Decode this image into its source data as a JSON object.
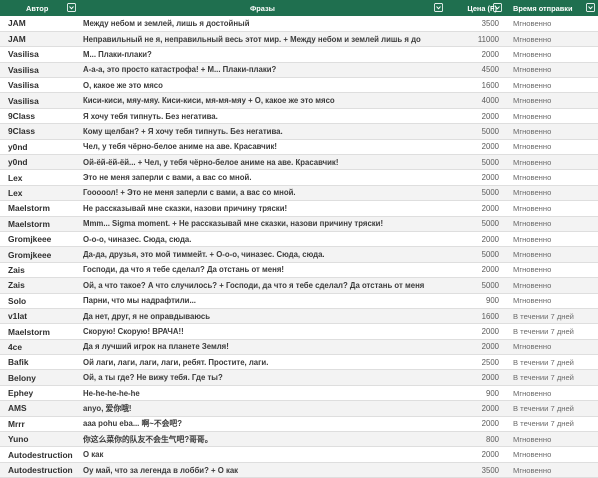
{
  "header": {
    "col_author": "Автор",
    "col_phrase": "Фразы",
    "col_price": "Цена (F)",
    "col_time": "Время отправки"
  },
  "rows": [
    {
      "author": "JAM",
      "phrase": "Между небом и землей, лишь я достойный",
      "price": "3500",
      "time": "Мгновенно"
    },
    {
      "author": "JAM",
      "phrase": "Неправильный не я, неправильный весь этот мир. + Между небом и землей лишь я до",
      "price": "11000",
      "time": "Мгновенно"
    },
    {
      "author": "Vasilisa",
      "phrase": "М... Плаки-плаки?",
      "price": "2000",
      "time": "Мгновенно"
    },
    {
      "author": "Vasilisa",
      "phrase": "А-а-а, это просто катастрофа! + М... Плаки-плаки?",
      "price": "4500",
      "time": "Мгновенно"
    },
    {
      "author": "Vasilisa",
      "phrase": "О, какое же это мясо",
      "price": "1600",
      "time": "Мгновенно"
    },
    {
      "author": "Vasilisa",
      "phrase": "Киси-киси, мяу-мяу. Киси-киси, мя-мя-мяу + О, какое же это мясо",
      "price": "4000",
      "time": "Мгновенно"
    },
    {
      "author": "9Class",
      "phrase": "Я хочу тебя типнуть. Без негатива.",
      "price": "2000",
      "time": "Мгновенно"
    },
    {
      "author": "9Class",
      "phrase": "Кому щелбан? + Я хочу тебя типнуть. Без негатива.",
      "price": "5000",
      "time": "Мгновенно"
    },
    {
      "author": "y0nd",
      "phrase": "Чел, у тебя чёрно-белое аниме на аве. Красавчик!",
      "price": "2000",
      "time": "Мгновенно"
    },
    {
      "author": "y0nd",
      "phrase": "Ой-ёй-ёй-ёй... + Чел, у тебя чёрно-белое аниме на аве. Красавчик!",
      "price": "5000",
      "time": "Мгновенно"
    },
    {
      "author": "Lex",
      "phrase": "Это не меня заперли с вами, а вас со мной.",
      "price": "2000",
      "time": "Мгновенно"
    },
    {
      "author": "Lex",
      "phrase": "Гооооол! + Это не меня заперли с вами, а вас со мной.",
      "price": "5000",
      "time": "Мгновенно"
    },
    {
      "author": "Maelstorm",
      "phrase": "Не рассказывай мне сказки, назови причину тряски!",
      "price": "2000",
      "time": "Мгновенно"
    },
    {
      "author": "Maelstorm",
      "phrase": "Mmm... Sigma moment. + Не рассказывай мне сказки, назови причину тряски!",
      "price": "5000",
      "time": "Мгновенно"
    },
    {
      "author": "Gromjkeee",
      "phrase": "О-о-о, чиназес. Сюда, сюда.",
      "price": "2000",
      "time": "Мгновенно"
    },
    {
      "author": "Gromjkeee",
      "phrase": "Да-да, друзья, это мой тиммейт. + О-о-о, чиназес. Сюда, сюда.",
      "price": "5000",
      "time": "Мгновенно"
    },
    {
      "author": "Zais",
      "phrase": "Господи, да что я тебе сделал? Да отстань от меня!",
      "price": "2000",
      "time": "Мгновенно"
    },
    {
      "author": "Zais",
      "phrase": "Ой, а что такое? А что случилось? + Господи, да что я тебе сделал? Да отстань от меня",
      "price": "5000",
      "time": "Мгновенно"
    },
    {
      "author": "Solo",
      "phrase": "Парни, что мы надрафтили...",
      "price": "900",
      "time": "Мгновенно"
    },
    {
      "author": "v1lat",
      "phrase": "Да нет, друг, я не оправдываюсь",
      "price": "1600",
      "time": "В течении 7 дней"
    },
    {
      "author": "Maelstorm",
      "phrase": "Скорую! Скорую! ВРАЧА!!",
      "price": "2000",
      "time": "В течении 7 дней"
    },
    {
      "author": "4ce",
      "phrase": "Да я лучший игрок на планете Земля!",
      "price": "2000",
      "time": "Мгновенно"
    },
    {
      "author": "Bafik",
      "phrase": "Ой лаги, лаги, лаги, лаги, ребят. Простите, лаги.",
      "price": "2500",
      "time": "В течении 7 дней"
    },
    {
      "author": "Belony",
      "phrase": "Ой, а ты где? Не вижу тебя. Где ты?",
      "price": "2000",
      "time": "В течении 7 дней"
    },
    {
      "author": "Ephey",
      "phrase": "He-he-he-he-he",
      "price": "900",
      "time": "Мгновенно"
    },
    {
      "author": "AMS",
      "phrase": "anyo, 爱你哦!",
      "price": "2000",
      "time": "В течении 7 дней"
    },
    {
      "author": "Mrrr",
      "phrase": "aaa pohu eba... 啊~不会吧?",
      "price": "2000",
      "time": "В течении 7 дней"
    },
    {
      "author": "Yuno",
      "phrase": "你这么菜你的队友不会生气吧?哥哥。",
      "price": "800",
      "time": "Мгновенно"
    },
    {
      "author": "Autodestruction",
      "phrase": "О как",
      "price": "2000",
      "time": "Мгновенно"
    },
    {
      "author": "Autodestruction",
      "phrase": "Оу май, что за легенда в лобби? + О как",
      "price": "3500",
      "time": "Мгновенно"
    }
  ],
  "icons": {
    "sort": "chevron-down-icon"
  },
  "colors": {
    "header_bg": "#1f6f4f",
    "header_text": "#ffffff"
  }
}
